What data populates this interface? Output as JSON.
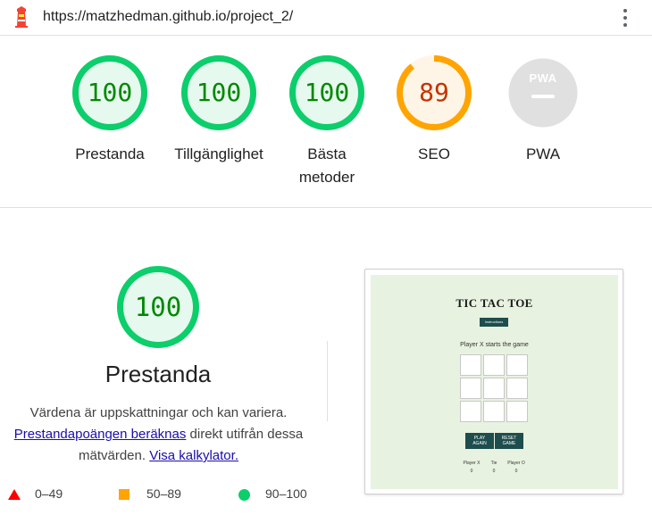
{
  "topbar": {
    "url": "https://matzhedman.github.io/project_2/"
  },
  "gauges": [
    {
      "score": "100",
      "label_lines": [
        "Prestanda"
      ],
      "score_value": 100,
      "status": "pass",
      "color": "#0cce6b"
    },
    {
      "score": "100",
      "label_lines": [
        "Tillgänglighet"
      ],
      "score_value": 100,
      "status": "pass",
      "color": "#0cce6b"
    },
    {
      "score": "100",
      "label_lines": [
        "Bästa",
        "metoder"
      ],
      "score_value": 100,
      "status": "pass",
      "color": "#0cce6b"
    },
    {
      "score": "89",
      "label_lines": [
        "SEO"
      ],
      "score_value": 89,
      "status": "average",
      "color": "#ffa400"
    },
    {
      "score": "",
      "label_lines": [
        "PWA"
      ],
      "score_value": null,
      "status": "pwa",
      "color": "#cccccc",
      "badge_text": "PWA"
    }
  ],
  "performance": {
    "score": "100",
    "score_value": 100,
    "title": "Prestanda",
    "desc_line1": "Värdena är uppskattningar och kan variera.",
    "desc_link1": "Prestandapoängen beräknas",
    "desc_mid": " direkt utifrån dessa",
    "desc_line3_text": "mätvärden. ",
    "desc_link2": "Visa kalkylator."
  },
  "legend": [
    {
      "range": "0–49",
      "shape": "triangle",
      "color": "#ff0000"
    },
    {
      "range": "50–89",
      "shape": "square",
      "color": "#ffa400"
    },
    {
      "range": "90–100",
      "shape": "circle",
      "color": "#0cce6b"
    }
  ],
  "thumbnail": {
    "title": "TIC TAC TOE",
    "instructions_label": "Instructions",
    "status": "Player X starts the game",
    "play_again_line1": "PLAY",
    "play_again_line2": "AGAIN",
    "reset_line1": "RESET",
    "reset_line2": "GAME",
    "scores": [
      {
        "label": "Player X",
        "value": "0"
      },
      {
        "label": "Tie",
        "value": "0"
      },
      {
        "label": "Player O",
        "value": "0"
      }
    ]
  },
  "icons": [
    "lighthouse-icon",
    "more-vert-icon"
  ],
  "colors": {
    "pass": "#0cce6b",
    "average": "#ffa400",
    "fail": "#ff0000",
    "pass_text": "#008800",
    "average_text": "#c33300"
  }
}
